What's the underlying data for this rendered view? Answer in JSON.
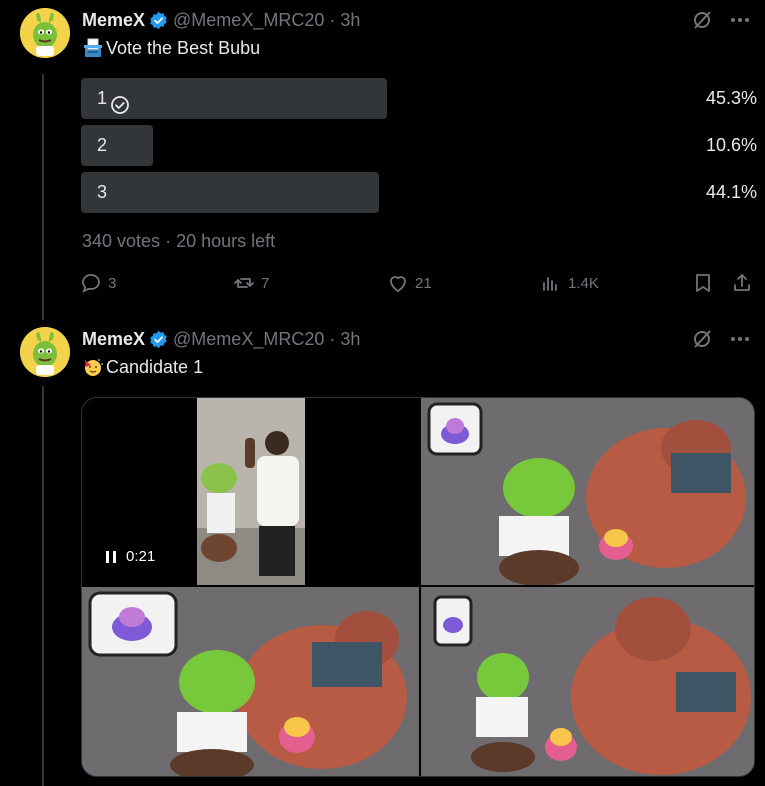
{
  "tweets": [
    {
      "user": {
        "name": "MemeX",
        "handle": "@MemeX_MRC20",
        "time": "3h"
      },
      "text": "Vote the Best Bubu",
      "emoji": "ballot-box",
      "poll": {
        "options": [
          {
            "label": "1",
            "percent": "45.3%",
            "fraction": 0.453,
            "selected": true
          },
          {
            "label": "2",
            "percent": "10.6%",
            "fraction": 0.106,
            "selected": false
          },
          {
            "label": "3",
            "percent": "44.1%",
            "fraction": 0.441,
            "selected": false
          }
        ],
        "votes": "340 votes",
        "time_left": "20 hours left"
      },
      "actions": {
        "replies": "3",
        "reposts": "7",
        "likes": "21",
        "views": "1.4K"
      }
    },
    {
      "user": {
        "name": "MemeX",
        "handle": "@MemeX_MRC20",
        "time": "3h"
      },
      "text": "Candidate 1",
      "emoji": "partying-face",
      "video": {
        "duration": "0:21"
      }
    }
  ],
  "separator": "·",
  "colors": {
    "background": "#000000",
    "text": "#e7e9ea",
    "muted": "#71767b",
    "poll_bar": "#333639",
    "verified": "#1d9bf0"
  }
}
